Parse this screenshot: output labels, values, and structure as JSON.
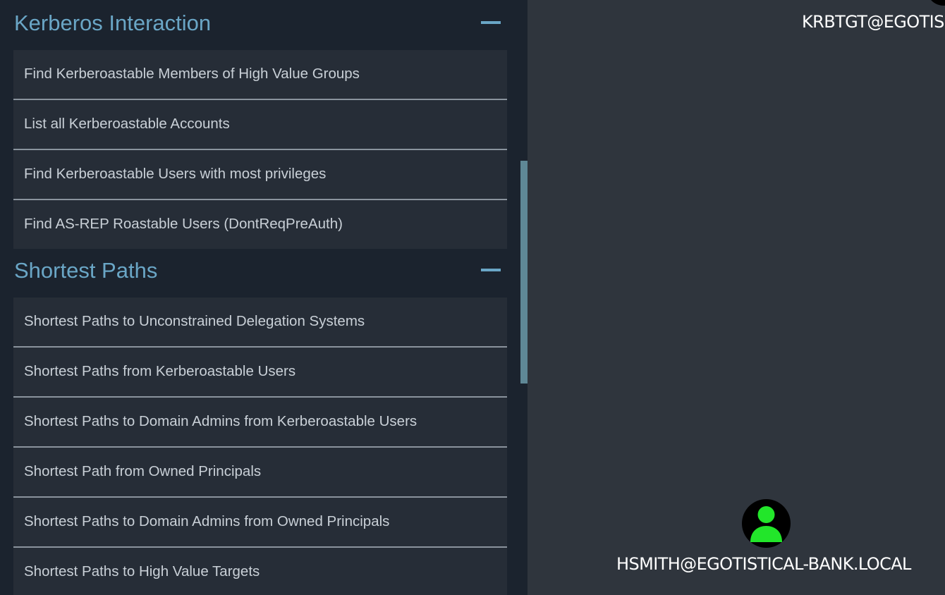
{
  "panel": {
    "sections": [
      {
        "title": "Kerberos Interaction",
        "collapse_icon": "minus-icon",
        "queries": [
          "Find Kerberoastable Members of High Value Groups",
          "List all Kerberoastable Accounts",
          "Find Kerberoastable Users with most privileges",
          "Find AS-REP Roastable Users (DontReqPreAuth)"
        ]
      },
      {
        "title": "Shortest Paths",
        "collapse_icon": "minus-icon",
        "queries": [
          "Shortest Paths to Unconstrained Delegation Systems",
          "Shortest Paths from Kerberoastable Users",
          "Shortest Paths to Domain Admins from Kerberoastable Users",
          "Shortest Path from Owned Principals",
          "Shortest Paths to Domain Admins from Owned Principals",
          "Shortest Paths to High Value Targets"
        ]
      }
    ]
  },
  "graph": {
    "nodes": [
      {
        "label": "KRBTGT@EGOTIS",
        "icon": "user-icon"
      },
      {
        "label": "HSMITH@EGOTISTICAL-BANK.LOCAL",
        "icon": "user-icon",
        "icon_color": "#22e62a"
      }
    ]
  },
  "colors": {
    "panel_bg": "#1b232e",
    "item_bg": "#262d37",
    "header_text": "#6aa6c6",
    "graph_bg": "#2f353d",
    "owned_user": "#22e62a"
  }
}
